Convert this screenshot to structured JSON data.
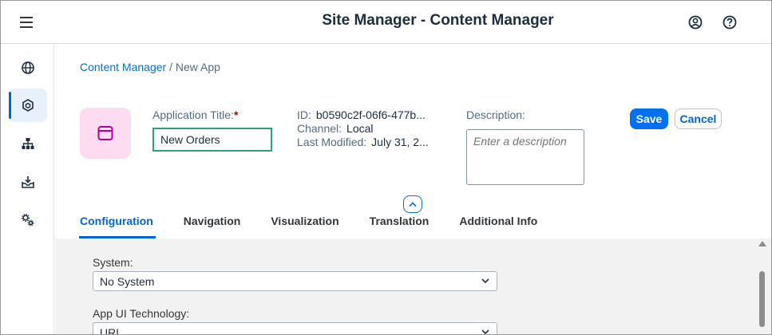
{
  "shell": {
    "title": "Site Manager - Content Manager",
    "menu_icon": "hamburger-icon",
    "profile_icon": "user-circle-icon",
    "help_icon": "help-icon"
  },
  "sidenav": {
    "items": [
      {
        "icon": "globe-icon"
      },
      {
        "icon": "cube-icon",
        "active": true
      },
      {
        "icon": "sitemap-icon"
      },
      {
        "icon": "inbox-download-icon"
      },
      {
        "icon": "gears-icon"
      }
    ]
  },
  "breadcrumb": {
    "parent": "Content Manager",
    "separator": " / ",
    "current": "New App"
  },
  "header": {
    "title_label": "Application Title:",
    "required_mark": "*",
    "title_value": "New Orders",
    "id_label": "ID:",
    "id_value": "b0590c2f-06f6-477b...",
    "channel_label": "Channel:",
    "channel_value": "Local",
    "modified_label": "Last Modified:",
    "modified_value": "July 31, 2...",
    "description_label": "Description:",
    "description_placeholder": "Enter a description",
    "save_label": "Save",
    "cancel_label": "Cancel"
  },
  "tabs": [
    {
      "label": "Configuration",
      "active": true
    },
    {
      "label": "Navigation"
    },
    {
      "label": "Visualization"
    },
    {
      "label": "Translation"
    },
    {
      "label": "Additional Info"
    }
  ],
  "form": {
    "system_label": "System:",
    "system_value": "No System",
    "tech_label": "App UI Technology:",
    "tech_value": "URL"
  },
  "colors": {
    "accent": "#0070f2",
    "tile_bg": "#fddcf2",
    "tile_icon": "#b0009e",
    "highlight_border": "#2aa37a"
  }
}
